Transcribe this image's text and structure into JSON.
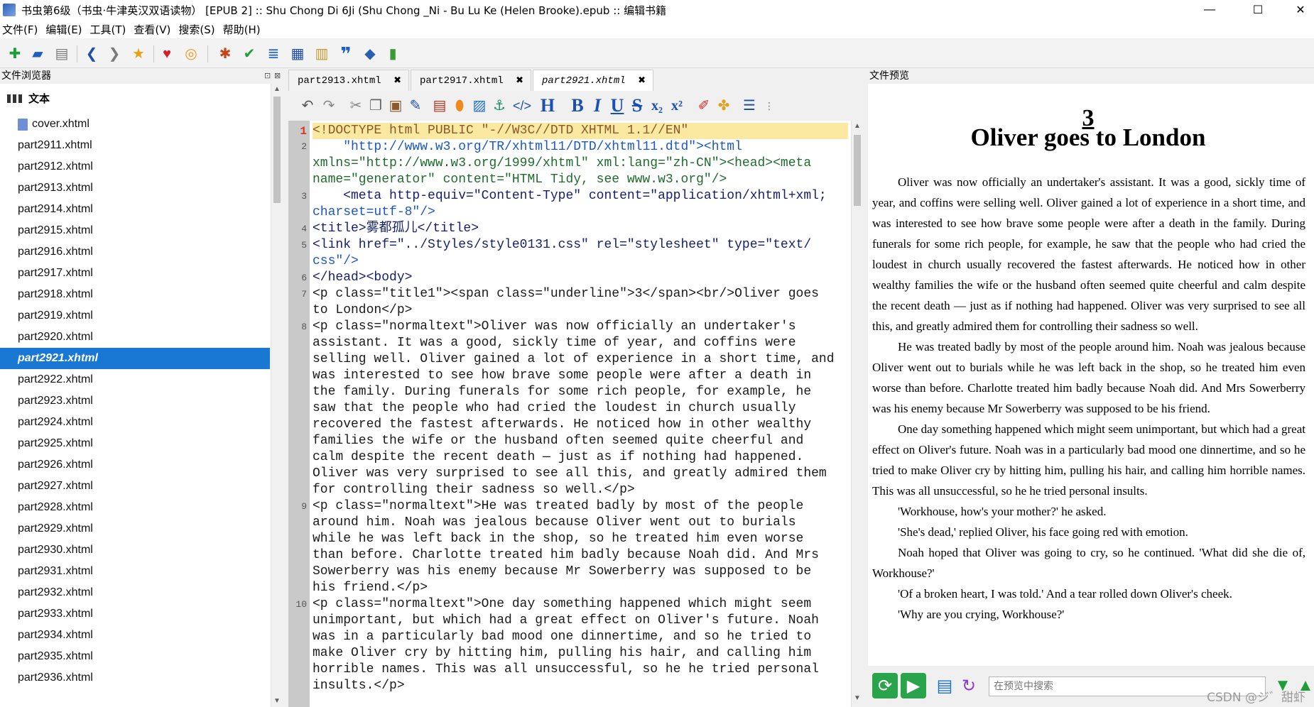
{
  "window": {
    "title": "书虫第6级（书虫·牛津英汉双语读物） [EPUB 2] :: Shu Chong Di 6Ji (Shu Chong _Ni - Bu Lu Ke  (Helen Brooke).epub :: 编辑书籍",
    "minimize": "—",
    "maximize": "☐",
    "close": "✕"
  },
  "menu": [
    "文件(F)",
    "编辑(E)",
    "工具(T)",
    "查看(V)",
    "搜索(S)",
    "帮助(H)"
  ],
  "file_browser": {
    "title": "文件浏览器",
    "folder": "文本",
    "files": [
      "cover.xhtml",
      "part2911.xhtml",
      "part2912.xhtml",
      "part2913.xhtml",
      "part2914.xhtml",
      "part2915.xhtml",
      "part2916.xhtml",
      "part2917.xhtml",
      "part2918.xhtml",
      "part2919.xhtml",
      "part2920.xhtml",
      "part2921.xhtml",
      "part2922.xhtml",
      "part2923.xhtml",
      "part2924.xhtml",
      "part2925.xhtml",
      "part2926.xhtml",
      "part2927.xhtml",
      "part2928.xhtml",
      "part2929.xhtml",
      "part2930.xhtml",
      "part2931.xhtml",
      "part2932.xhtml",
      "part2933.xhtml",
      "part2934.xhtml",
      "part2935.xhtml",
      "part2936.xhtml"
    ],
    "selected_index": 11
  },
  "tabs": [
    "part2913.xhtml",
    "part2917.xhtml",
    "part2921.xhtml"
  ],
  "active_tab": 2,
  "editor": {
    "line_numbers": [
      "1",
      "2",
      "3",
      "4",
      "5",
      "6",
      "7",
      "8",
      "9",
      "10"
    ],
    "line1": "<!DOCTYPE html PUBLIC \"-//W3C//DTD XHTML 1.1//EN\"",
    "line2a": "    \"http://www.w3.org/TR/xhtml11/DTD/xhtml11.dtd\"><html",
    "line2b": "xmlns=\"http://www.w3.org/1999/xhtml\" xml:lang=\"zh-CN\"><head><meta",
    "line2c": "name=\"generator\" content=\"HTML Tidy, see www.w3.org\"/>",
    "line3a": "    <meta http-equiv=\"Content-Type\" content=\"application/xhtml+xml;",
    "line3b": "charset=utf-8\"/>",
    "line4": "<title>雾都孤儿</title>",
    "line5a": "<link href=\"../Styles/style0131.css\" rel=\"stylesheet\" type=\"text/",
    "line5b": "css\"/>",
    "line6": "</head><body>",
    "line7a": "<p class=\"title1\"><span class=\"underline\">3</span><br/>Oliver goes",
    "line7b": "to London</p>",
    "line8": [
      "<p class=\"normaltext\">Oliver was now officially an undertaker's",
      "assistant. It was a good, sickly time of year, and coffins were",
      "selling well. Oliver gained a lot of experience in a short time, and",
      "was interested to see how brave some people were after a death in",
      "the family. During funerals for some rich people, for example, he",
      "saw that the people who had cried the loudest in church usually",
      "recovered the fastest afterwards. He noticed how in other wealthy",
      "families the wife or the husband often seemed quite cheerful and",
      "calm despite the recent death — just as if nothing had happened.",
      "Oliver was very surprised to see all this, and greatly admired them",
      "for controlling their sadness so well.</p>"
    ],
    "line9": [
      "<p class=\"normaltext\">He was treated badly by most of the people",
      "around him. Noah was jealous because Oliver went out to burials",
      "while he was left back in the shop, so he treated him even worse",
      "than before. Charlotte treated him badly because Noah did. And Mrs",
      "Sowerberry was his enemy because Mr Sowerberry was supposed to be",
      "his friend.</p>"
    ],
    "line10": [
      "<p class=\"normaltext\">One day something happened which might seem",
      "unimportant, but which had a great effect on Oliver's future. Noah",
      "was in a particularly bad mood one dinnertime, and so he tried to",
      "make Oliver cry by hitting him, pulling his hair, and calling him",
      "horrible names. This was all unsuccessful, so he he tried personal",
      "insults.</p>"
    ]
  },
  "preview": {
    "title": "文件预览",
    "chapter_number": "3",
    "chapter_title": "Oliver goes to London",
    "paragraphs": [
      "Oliver was now officially an undertaker's assistant. It was a good, sickly time of year, and coffins were selling well. Oliver gained a lot of experience in a short time, and was interested to see how brave some people were after a death in the family. During funerals for some rich people, for example, he saw that the people who had cried the loudest in church usually recovered the fastest afterwards. He noticed how in other wealthy families the wife or the husband often seemed quite cheerful and calm despite the recent death — just as if nothing had happened. Oliver was very surprised to see all this, and greatly admired them for controlling their sadness so well.",
      "He was treated badly by most of the people around him. Noah was jealous because Oliver went out to burials while he was left back in the shop, so he treated him even worse than before. Charlotte treated him badly because Noah did. And Mrs Sowerberry was his enemy because Mr Sowerberry was supposed to be his friend.",
      "One day something happened which might seem unimportant, but which had a great effect on Oliver's future. Noah was in a particularly bad mood one dinnertime, and so he tried to make Oliver cry by hitting him, pulling his hair, and calling him horrible names. This was all unsuccessful, so he he tried personal insults.",
      "'Workhouse, how's your mother?' he asked.",
      "'She's dead,' replied Oliver, his face going red with emotion.",
      "Noah hoped that Oliver was going to cry, so he continued. 'What did she die of, Workhouse?'",
      "'Of a broken heart, I was told.' And a tear rolled down Oliver's cheek.",
      "'Why are you crying, Workhouse?'"
    ],
    "search_placeholder": "在预览中搜索",
    "watermark": "CSDN @ジ゛甜虾"
  },
  "colors": {
    "selection": "#1878d4",
    "current_line": "#fbe9a2",
    "gutter": "#c9c9c9"
  }
}
